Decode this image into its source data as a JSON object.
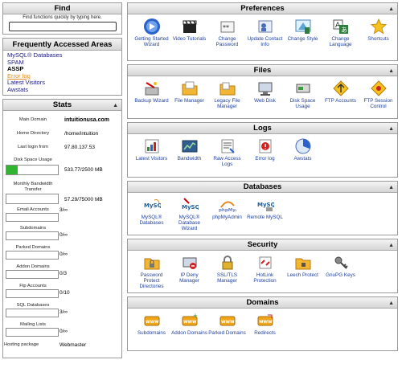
{
  "find": {
    "title": "Find",
    "hint": "Find functions quickly by typing here.",
    "value": ""
  },
  "frequent": {
    "title": "Frequently Accessed Areas",
    "items": [
      "MySQL® Databases",
      "SPAM",
      "ASSP",
      "Error log",
      "Latest Visitors",
      "Awstats"
    ]
  },
  "stats": {
    "title": "Stats",
    "main_domain_label": "Main Domain",
    "main_domain": "intuitionusa.com",
    "home_dir_label": "Home Directory",
    "home_dir": "/home/intuition",
    "last_login_label": "Last login from",
    "last_login": "97.80.137.53",
    "disk_label": "Disk Space Usage",
    "disk_value": "533.77/2500 MB",
    "disk_fraction": 0.213,
    "bandwidth_label": "Monthly Bandwidth Transfer",
    "bandwidth_value": "57.29/75000 MB",
    "email_label": "Email Accounts",
    "email_value": "3/∞",
    "subdomains_label": "Subdomains",
    "subdomains_value": "0/∞",
    "parked_label": "Parked Domains",
    "parked_value": "0/∞",
    "addon_label": "Addon Domains",
    "addon_value": "0/3",
    "ftp_label": "Ftp Accounts",
    "ftp_value": "0/10",
    "sql_label": "SQL Databases",
    "sql_value": "3/∞",
    "lists_label": "Mailing Lists",
    "lists_value": "0/∞",
    "package_label": "Hosting package",
    "package_value": "Webmaster"
  },
  "preferences": {
    "title": "Preferences",
    "items": [
      {
        "label": "Getting Started Wizard",
        "icon": "wizard-icon"
      },
      {
        "label": "Video Tutorials",
        "icon": "clapperboard-icon"
      },
      {
        "label": "Change Password",
        "icon": "password-icon"
      },
      {
        "label": "Update Contact Info",
        "icon": "contact-icon"
      },
      {
        "label": "Change Style",
        "icon": "style-icon"
      },
      {
        "label": "Change Language",
        "icon": "language-icon"
      },
      {
        "label": "Shortcuts",
        "icon": "star-icon"
      }
    ]
  },
  "files": {
    "title": "Files",
    "items": [
      {
        "label": "Backup Wizard",
        "icon": "backup-wizard-icon"
      },
      {
        "label": "File Manager",
        "icon": "file-manager-icon"
      },
      {
        "label": "Legacy File Manager",
        "icon": "legacy-file-manager-icon"
      },
      {
        "label": "Web Disk",
        "icon": "web-disk-icon"
      },
      {
        "label": "Disk Space Usage",
        "icon": "disk-usage-icon"
      },
      {
        "label": "FTP Accounts",
        "icon": "ftp-icon"
      },
      {
        "label": "FTP Session Control",
        "icon": "ftp-session-icon"
      }
    ]
  },
  "logs": {
    "title": "Logs",
    "items": [
      {
        "label": "Latest Visitors",
        "icon": "visitors-icon"
      },
      {
        "label": "Bandwidth",
        "icon": "bandwidth-icon"
      },
      {
        "label": "Raw Access Logs",
        "icon": "raw-logs-icon"
      },
      {
        "label": "Error log",
        "icon": "error-log-icon"
      },
      {
        "label": "Awstats",
        "icon": "awstats-icon"
      }
    ]
  },
  "databases": {
    "title": "Databases",
    "items": [
      {
        "label": "MySQL® Databases",
        "icon": "mysql-icon"
      },
      {
        "label": "MySQL® Database Wizard",
        "icon": "mysql-wizard-icon"
      },
      {
        "label": "phpMyAdmin",
        "icon": "phpmyadmin-icon"
      },
      {
        "label": "Remote MySQL",
        "icon": "remote-mysql-icon"
      }
    ]
  },
  "security": {
    "title": "Security",
    "items": [
      {
        "label": "Password Protect Directories",
        "icon": "folder-lock-icon"
      },
      {
        "label": "IP Deny Manager",
        "icon": "ip-deny-icon"
      },
      {
        "label": "SSL/TLS Manager",
        "icon": "ssl-icon"
      },
      {
        "label": "HotLink Protection",
        "icon": "hotlink-icon"
      },
      {
        "label": "Leech Protect",
        "icon": "leech-icon"
      },
      {
        "label": "GnuPG Keys",
        "icon": "keys-icon"
      }
    ]
  },
  "domains": {
    "title": "Domains",
    "items": [
      {
        "label": "Subdomains",
        "icon": "subdomains-icon"
      },
      {
        "label": "Addon Domains",
        "icon": "addon-domains-icon"
      },
      {
        "label": "Parked Domains",
        "icon": "parked-domains-icon"
      },
      {
        "label": "Redirects",
        "icon": "redirects-icon"
      }
    ]
  }
}
